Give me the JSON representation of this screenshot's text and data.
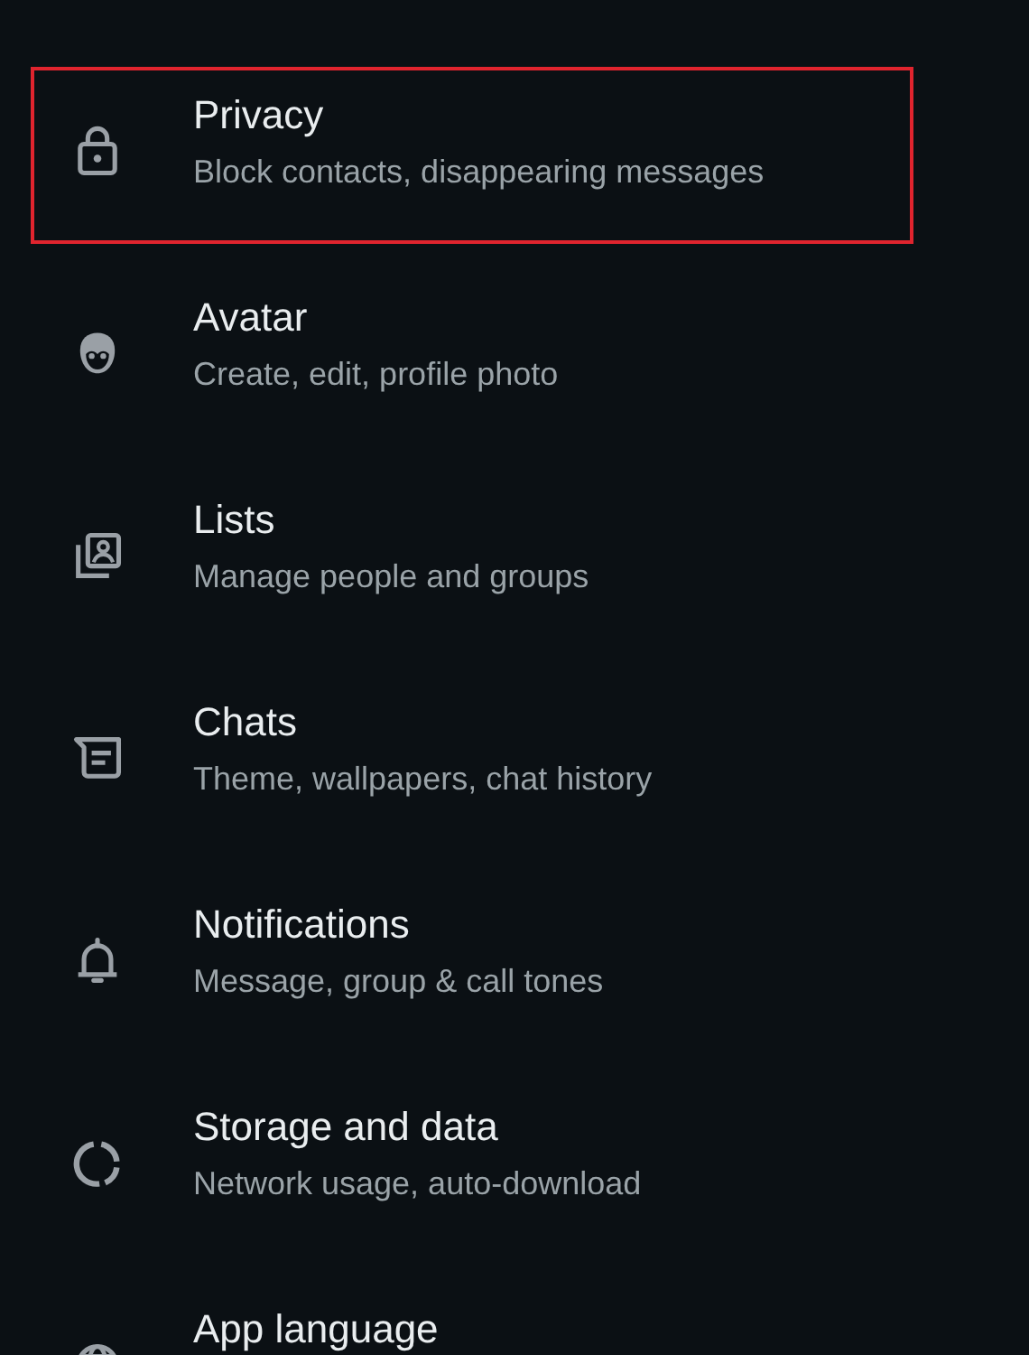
{
  "settings": [
    {
      "kind": "lock",
      "title": "Privacy",
      "subtitle": "Block contacts, disappearing messages",
      "highlighted": true
    },
    {
      "kind": "avatar",
      "title": "Avatar",
      "subtitle": "Create, edit, profile photo",
      "highlighted": false
    },
    {
      "kind": "lists",
      "title": "Lists",
      "subtitle": "Manage people and groups",
      "highlighted": false
    },
    {
      "kind": "chats",
      "title": "Chats",
      "subtitle": "Theme, wallpapers, chat history",
      "highlighted": false
    },
    {
      "kind": "bell",
      "title": "Notifications",
      "subtitle": "Message, group & call tones",
      "highlighted": false
    },
    {
      "kind": "storage",
      "title": "Storage and data",
      "subtitle": "Network usage, auto-download",
      "highlighted": false
    },
    {
      "kind": "globe",
      "title": "App language",
      "highlighted": false
    }
  ]
}
